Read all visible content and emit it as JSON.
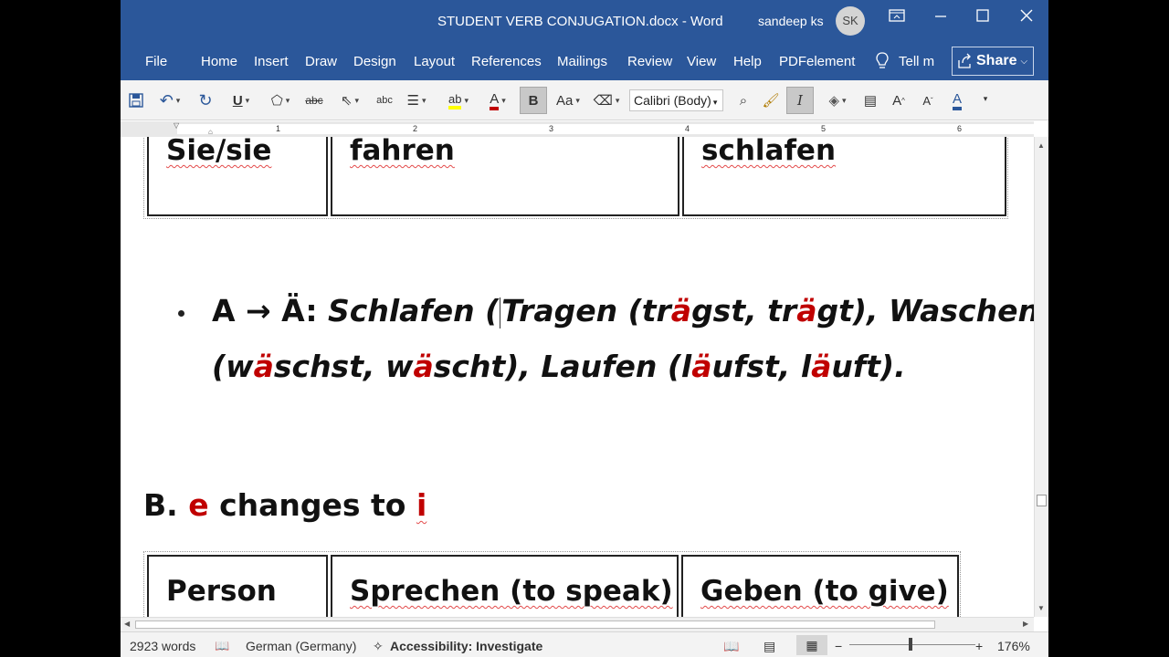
{
  "window": {
    "title": "STUDENT VERB CONJUGATION.docx  -  Word",
    "user_name": "sandeep ks",
    "user_initials": "SK"
  },
  "ribbon": {
    "tabs": [
      "File",
      "Home",
      "Insert",
      "Draw",
      "Design",
      "Layout",
      "References",
      "Mailings",
      "Review",
      "View",
      "Help",
      "PDFelement"
    ],
    "tell_me": "Tell m",
    "share": "Share"
  },
  "toolbar": {
    "font_name": "Calibri (Body)",
    "bold_label": "B",
    "italic_label": "I",
    "underline_label": "U",
    "font_case_label": "Aa",
    "font_color_label": "A",
    "grow_label": "A",
    "shrink_label": "A",
    "strikethrough_label": "abc",
    "spelling_label": "abc"
  },
  "ruler": {
    "numbers": [
      "1",
      "2",
      "3",
      "4",
      "5",
      "6"
    ]
  },
  "document": {
    "top_table": {
      "cells": [
        "Sie/sie",
        "fahren",
        "schlafen"
      ]
    },
    "bullet": {
      "line1": {
        "lead": "A → Ä: ",
        "p1": "Schlafen (",
        "p2": "Tragen (tr",
        "r1": "ä",
        "p3": "gst, tr",
        "r2": "ä",
        "p4": "gt), Waschen"
      },
      "line2": {
        "p1": "(w",
        "r1": "ä",
        "p2": "schst, w",
        "r2": "ä",
        "p3": "scht), Laufen (l",
        "r3": "ä",
        "p4": "ufst, l",
        "r4": "ä",
        "p5": "uft)."
      }
    },
    "heading": {
      "prefix": "B. ",
      "e": "e",
      "middle": " changes to ",
      "i": "i"
    },
    "bottom_table": {
      "cells": [
        "Person",
        "Sprechen (to speak)",
        "Geben (to give)"
      ]
    }
  },
  "statusbar": {
    "words": "2923 words",
    "language": "German (Germany)",
    "accessibility": "Accessibility: Investigate",
    "zoom": "176%"
  },
  "colors": {
    "word_blue": "#2b579a",
    "highlight_red": "#c00000"
  }
}
